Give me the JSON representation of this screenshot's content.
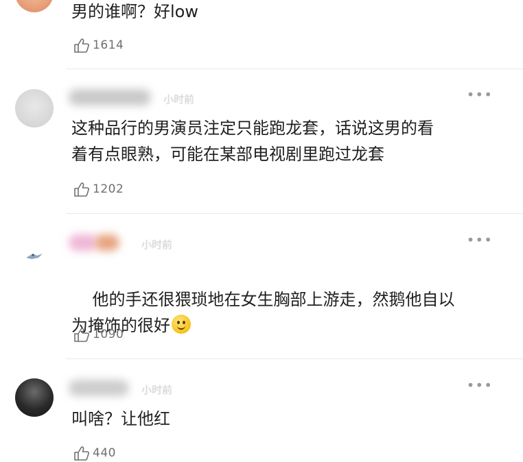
{
  "comments": [
    {
      "time": "",
      "text": "男的谁啊？好low",
      "likes": "1614"
    },
    {
      "time": "小时前",
      "text": "这种品行的男演员注定只能跑龙套，话说这男的看\n着有点眼熟，可能在某部电视剧里跑过龙套",
      "likes": "1202"
    },
    {
      "time": "小时前",
      "text": "他的手还很猥琐地在女生胸部上游走，然鹅他自以\n为掩饰的很好",
      "likes": "1090"
    },
    {
      "time": "小时前",
      "text": "叫啥？让他红",
      "likes": "440"
    }
  ],
  "icons": {
    "like": "thumbs-up-icon",
    "more": "more-dots-icon",
    "emoji": "smile-emoji-icon"
  },
  "more_label": "•••"
}
